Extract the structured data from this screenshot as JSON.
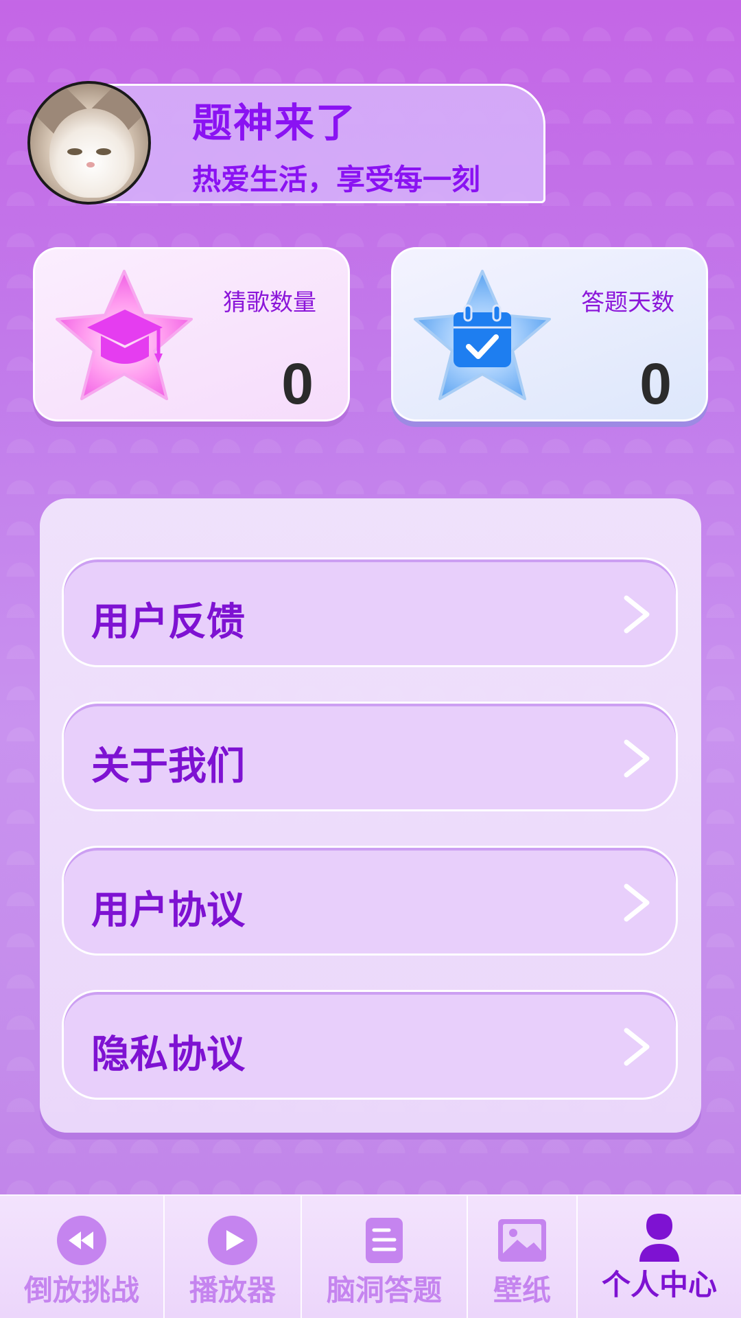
{
  "profile": {
    "name": "题神来了",
    "motto": "热爱生活，享受每一刻"
  },
  "stats": [
    {
      "label": "猜歌数量",
      "value": "0",
      "icon": "graduation-cap-icon",
      "color": "#e53df0"
    },
    {
      "label": "答题天数",
      "value": "0",
      "icon": "calendar-check-icon",
      "color": "#1e7ef0"
    }
  ],
  "menu": [
    {
      "label": "用户反馈"
    },
    {
      "label": "关于我们"
    },
    {
      "label": "用户协议"
    },
    {
      "label": "隐私协议"
    }
  ],
  "nav": [
    {
      "label": "倒放挑战",
      "icon": "rewind-icon",
      "active": false
    },
    {
      "label": "播放器",
      "icon": "play-icon",
      "active": false
    },
    {
      "label": "脑洞答题",
      "icon": "document-icon",
      "active": false
    },
    {
      "label": "壁纸",
      "icon": "image-icon",
      "active": false
    },
    {
      "label": "个人中心",
      "icon": "user-icon",
      "active": true
    }
  ],
  "colors": {
    "accent": "#8a12f2",
    "nav_inactive": "#c584ef",
    "nav_active": "#7e12d2"
  }
}
